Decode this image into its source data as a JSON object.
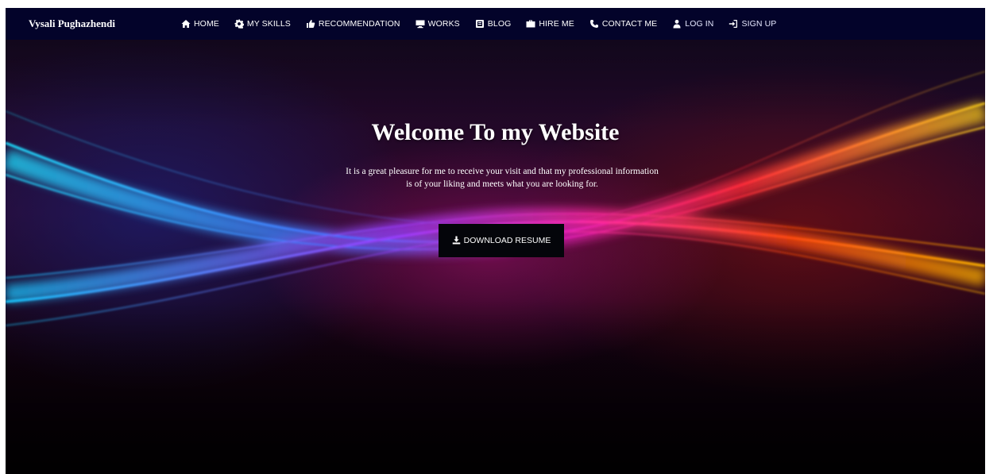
{
  "brand": "Vysali Pughazhendi",
  "nav": {
    "items": [
      {
        "label": "HOME",
        "icon": "home-icon"
      },
      {
        "label": "MY SKILLS",
        "icon": "gear-icon"
      },
      {
        "label": "RECOMMENDATION",
        "icon": "thumbs-up-icon"
      },
      {
        "label": "WORKS",
        "icon": "monitor-icon"
      },
      {
        "label": "BLOG",
        "icon": "blog-icon"
      },
      {
        "label": "HIRE ME",
        "icon": "briefcase-icon"
      },
      {
        "label": "CONTACT ME",
        "icon": "phone-icon"
      },
      {
        "label": "LOG IN",
        "icon": "user-icon"
      },
      {
        "label": "SIGN UP",
        "icon": "sign-in-icon"
      }
    ]
  },
  "hero": {
    "title": "Welcome To my Website",
    "subtitle_line1": "It is a great pleasure for me to receive your visit and that my professional information",
    "subtitle_line2": "is of your liking and meets what you are looking for.",
    "button_label": "DOWNLOAD RESUME",
    "button_icon": "download-icon"
  },
  "colors": {
    "navbar_bg": "#03032a",
    "button_bg": "#04050a",
    "text": "#ffffff"
  }
}
